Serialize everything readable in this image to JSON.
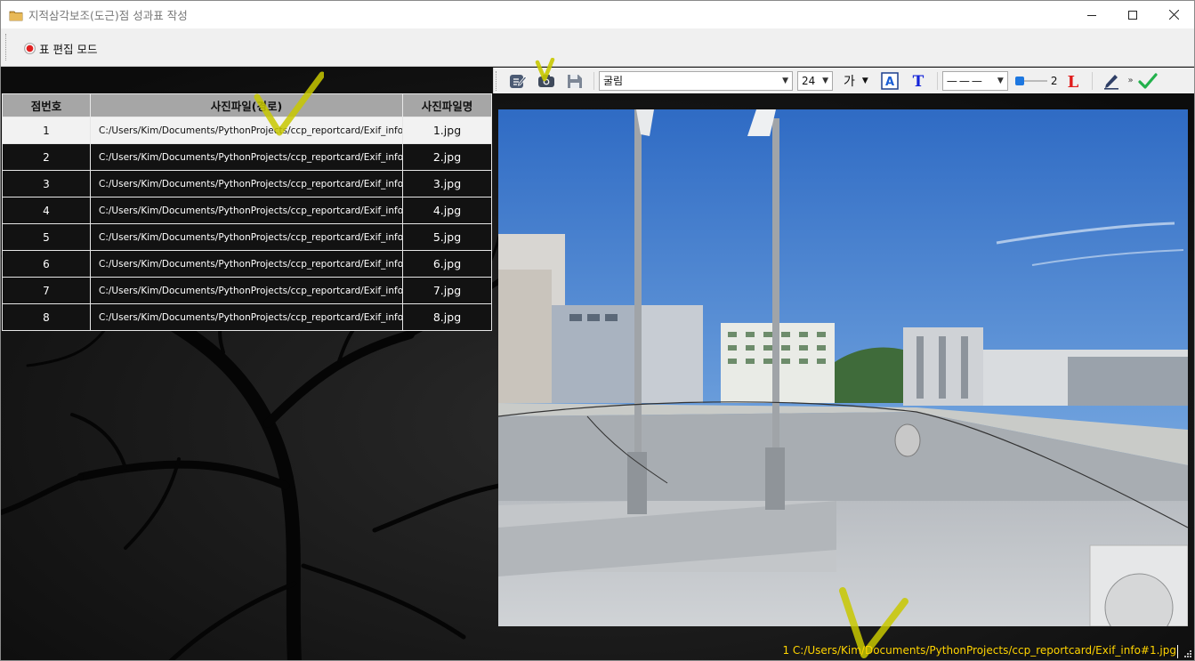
{
  "window": {
    "title": "지적삼각보조(도근)점 성과표 작성"
  },
  "modebar": {
    "toggle_label": "표 편집 모드"
  },
  "toolbar": {
    "font_family": "굴림",
    "font_size": "24",
    "text_sample": "가",
    "line_style": "———",
    "line_width": "2"
  },
  "table": {
    "headers": [
      "점번호",
      "사진파일(경로)",
      "사진파일명"
    ],
    "rows": [
      {
        "num": "1",
        "path": "C:/Users/Kim/Documents/PythonProjects/ccp_reportcard/Exif_info",
        "fname": "1.jpg"
      },
      {
        "num": "2",
        "path": "C:/Users/Kim/Documents/PythonProjects/ccp_reportcard/Exif_info",
        "fname": "2.jpg"
      },
      {
        "num": "3",
        "path": "C:/Users/Kim/Documents/PythonProjects/ccp_reportcard/Exif_info",
        "fname": "3.jpg"
      },
      {
        "num": "4",
        "path": "C:/Users/Kim/Documents/PythonProjects/ccp_reportcard/Exif_info",
        "fname": "4.jpg"
      },
      {
        "num": "5",
        "path": "C:/Users/Kim/Documents/PythonProjects/ccp_reportcard/Exif_info",
        "fname": "5.jpg"
      },
      {
        "num": "6",
        "path": "C:/Users/Kim/Documents/PythonProjects/ccp_reportcard/Exif_info",
        "fname": "6.jpg"
      },
      {
        "num": "7",
        "path": "C:/Users/Kim/Documents/PythonProjects/ccp_reportcard/Exif_info",
        "fname": "7.jpg"
      },
      {
        "num": "8",
        "path": "C:/Users/Kim/Documents/PythonProjects/ccp_reportcard/Exif_info",
        "fname": "8.jpg"
      }
    ]
  },
  "status": {
    "text": "1  C:/Users/Kim/Documents/PythonProjects/ccp_reportcard/Exif_info#1.jpg"
  },
  "colors": {
    "accent_green": "#22b14c",
    "status_yellow": "#ffd400",
    "selected_row": "#f2f2f2",
    "header_gray": "#a6a6a6"
  }
}
